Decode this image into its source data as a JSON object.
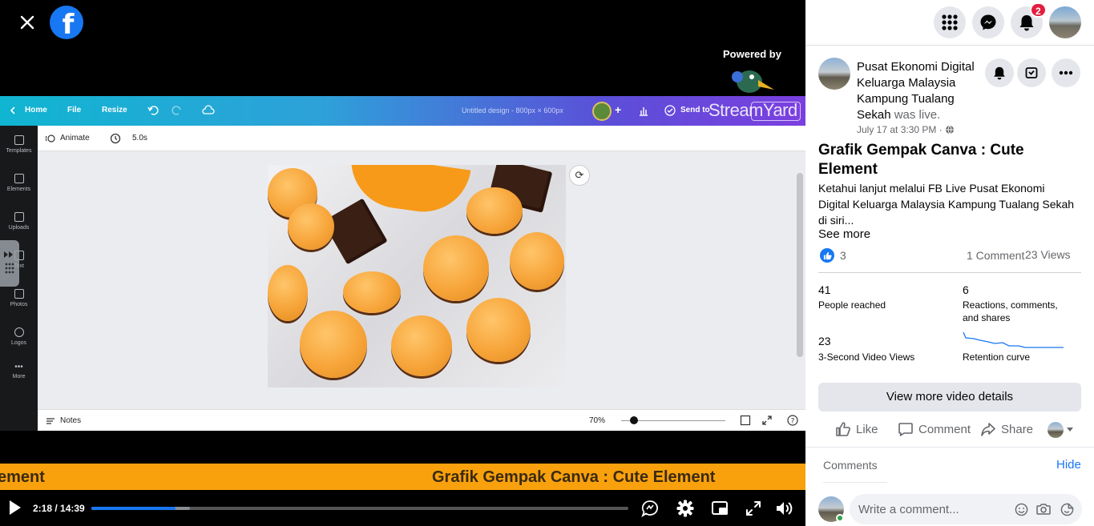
{
  "video": {
    "powered_by": "Powered by",
    "stream_brand": "StreamYard",
    "canva": {
      "menu_home": "Home",
      "menu_file": "File",
      "menu_resize": "Resize",
      "doc_title": "Untitled design - 800px × 600px",
      "send_label": "Send to",
      "animate_label": "Animate",
      "duration_label": "5.0s",
      "notes_label": "Notes",
      "zoom_label": "70%",
      "side_items": [
        "Templates",
        "Elements",
        "Uploads",
        "Text",
        "Photos",
        "Logos",
        "More"
      ]
    },
    "banner_left": "ement",
    "banner_main": "Grafik Gempak Canva : Cute Element",
    "time": "2:18 / 14:39",
    "progress_played": 0.157,
    "progress_buffered": 0.184
  },
  "header": {
    "notif_count": "2"
  },
  "post": {
    "page_name": "Pusat Ekonomi Digital Keluarga Malaysia Kampung Tualang Sekah",
    "was_live": "was live.",
    "date": "July 17 at 3:30 PM ·",
    "title": "Grafik Gempak Canva : Cute Element",
    "description": "Ketahui lanjut melalui FB Live Pusat Ekonomi Digital Keluarga Malaysia Kampung Tualang Sekah di siri...",
    "see_more": "See more",
    "like_count": "3",
    "comment_count": "1 Comment",
    "view_count": "23 Views"
  },
  "stats": {
    "reached_num": "41",
    "reached_lbl": "People reached",
    "reactions_num": "6",
    "reactions_lbl": "Reactions, comments, and shares",
    "views3s_num": "23",
    "views3s_lbl": "3-Second Video Views",
    "retention_lbl": "Retention curve"
  },
  "actions": {
    "details_btn": "View more video details",
    "like": "Like",
    "comment": "Comment",
    "share": "Share"
  },
  "comments": {
    "label": "Comments",
    "hide": "Hide",
    "placeholder": "Write a comment..."
  },
  "colors": {
    "fb_blue": "#1877f2",
    "banner": "#f9a10d",
    "badge": "#e41e3f"
  }
}
